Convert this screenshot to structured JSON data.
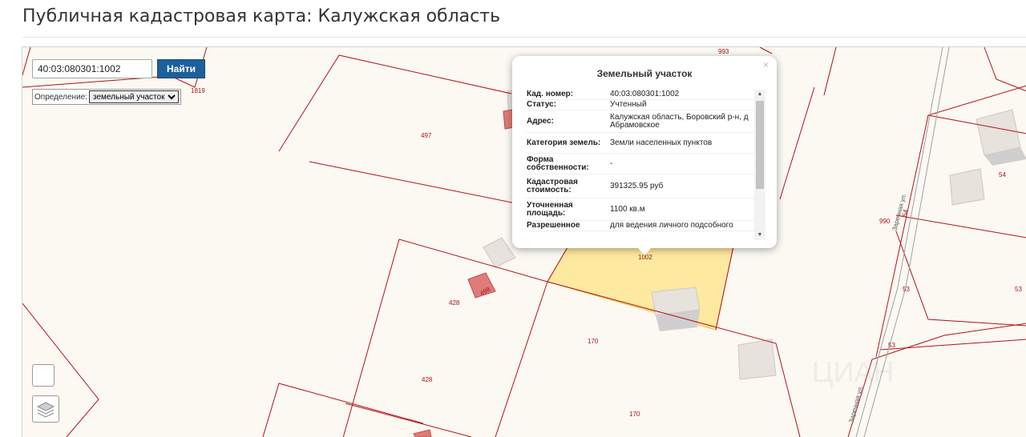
{
  "page": {
    "title": "Публичная кадастровая карта: Калужская область"
  },
  "search": {
    "value": "40:03:080301:1002",
    "button_label": "Найти"
  },
  "definition": {
    "label": "Определение:",
    "selected": "земельный участок"
  },
  "popup": {
    "title": "Земельный участок",
    "close": "×",
    "rows": [
      {
        "key": "Кад. номер:",
        "value": "40:03:080301:1002"
      },
      {
        "key": "Статус:",
        "value": "Учтенный"
      },
      {
        "key": "Адрес:",
        "value": "Калужская область, Боровский р-н, д Абрамовское"
      },
      {
        "key": "Категория земель:",
        "value": "Земли населенных пунктов"
      },
      {
        "key": "Форма собственности:",
        "value": "-"
      },
      {
        "key": "Кадастровая стоимость:",
        "value": "391325.95 руб"
      },
      {
        "key": "Уточненная площадь:",
        "value": "1100 кв.м"
      },
      {
        "key": "Разрешенное",
        "value": "для ведения личного подсобного"
      }
    ]
  },
  "map_labels": {
    "p993": "993",
    "p1819": "1819",
    "p497": "497",
    "p1002": "1002",
    "p498": "498",
    "p428a": "428",
    "p428b": "428",
    "p170a": "170",
    "p170b": "170",
    "p990": "990",
    "p54a": "54",
    "p54b": "54",
    "p53a": "53",
    "p53b": "53",
    "p53c": "53",
    "street1": "Заречная ул.",
    "street2": "Заречная ул."
  },
  "colors": {
    "selected_parcel": "#fde9a0",
    "parcel_line": "#b1121a",
    "search_button": "#1c5f9a"
  },
  "icons": {
    "layers": "layers-icon"
  }
}
